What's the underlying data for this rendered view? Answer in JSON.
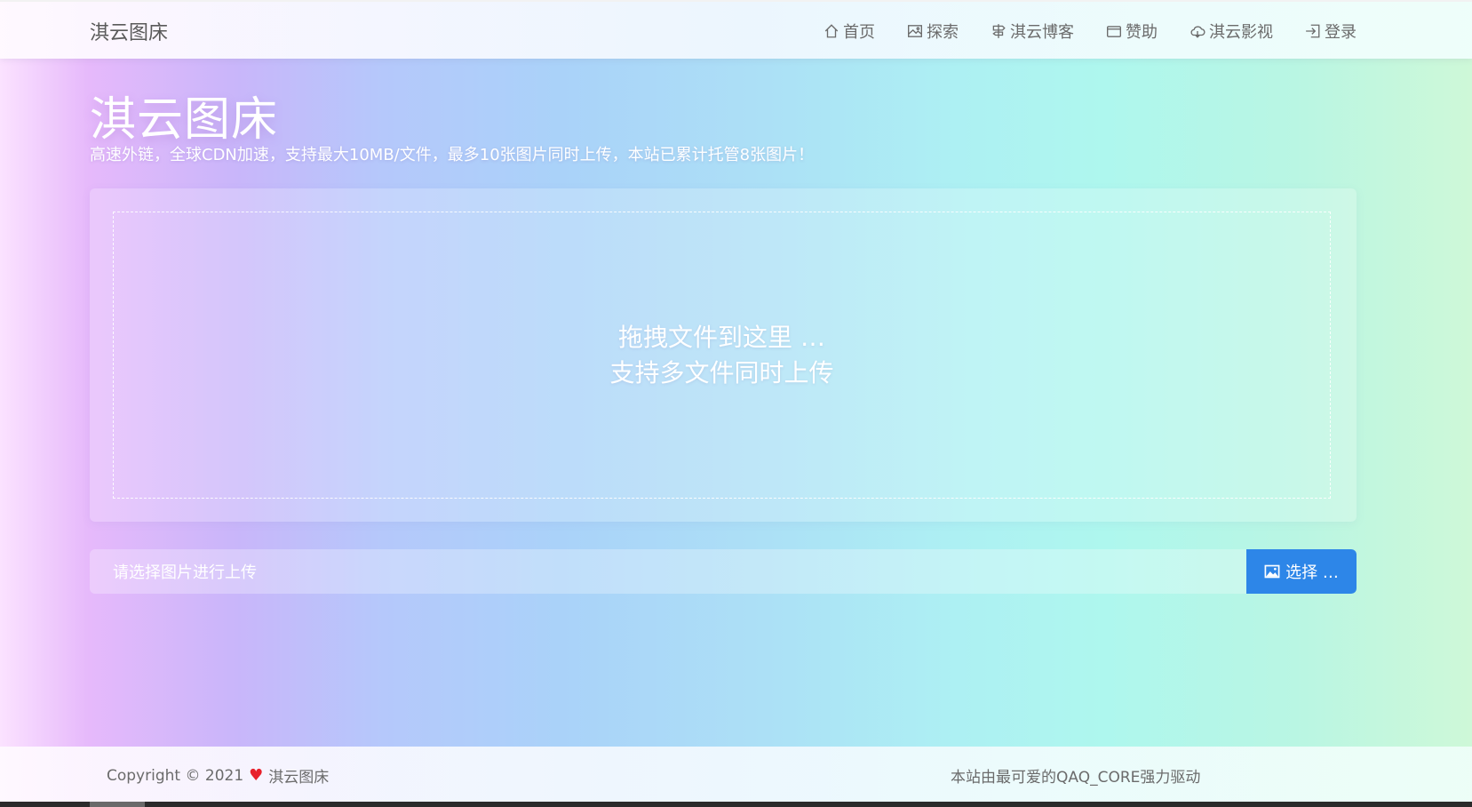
{
  "header": {
    "brand": "淇云图床",
    "nav": [
      {
        "label": "首页",
        "icon": "home-icon"
      },
      {
        "label": "探索",
        "icon": "image-icon"
      },
      {
        "label": "淇云博客",
        "icon": "signpost-icon"
      },
      {
        "label": "赞助",
        "icon": "wallet-icon"
      },
      {
        "label": "淇云影视",
        "icon": "cloud-icon"
      },
      {
        "label": "登录",
        "icon": "login-icon"
      }
    ]
  },
  "hero": {
    "title": "淇云图床",
    "subtitle": "高速外链，全球CDN加速，支持最大10MB/文件，最多10张图片同时上传，本站已累计托管8张图片！"
  },
  "dropzone": {
    "line1": "拖拽文件到这里 …",
    "line2": "支持多文件同时上传"
  },
  "upload": {
    "placeholder": "请选择图片进行上传",
    "button_label": "选择 …",
    "button_color": "#2d86e8"
  },
  "footer": {
    "copyright": "Copyright © 2021",
    "heart": "♥",
    "site_name": "淇云图床",
    "powered_by": "本站由最可爱的QAQ_CORE强力驱动"
  }
}
